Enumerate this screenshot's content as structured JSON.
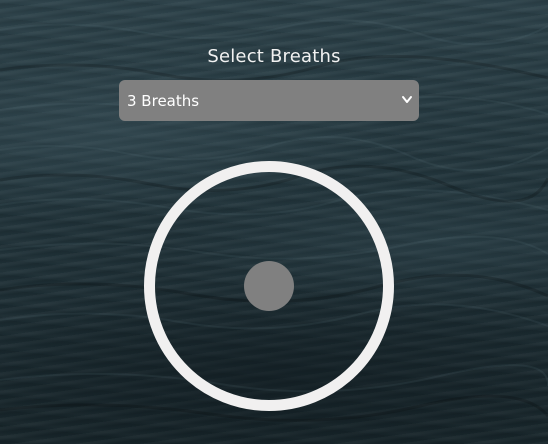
{
  "header": {
    "title": "Select Breaths"
  },
  "breath_selector": {
    "selected": "3 Breaths",
    "options": [
      "3 Breaths"
    ]
  },
  "colors": {
    "ring": "#f1f0f0",
    "dot": "#808080",
    "select_bg": "#808080",
    "title_text": "#f2f2f2"
  },
  "icons": {
    "select_arrow": "chevron-down-icon"
  }
}
